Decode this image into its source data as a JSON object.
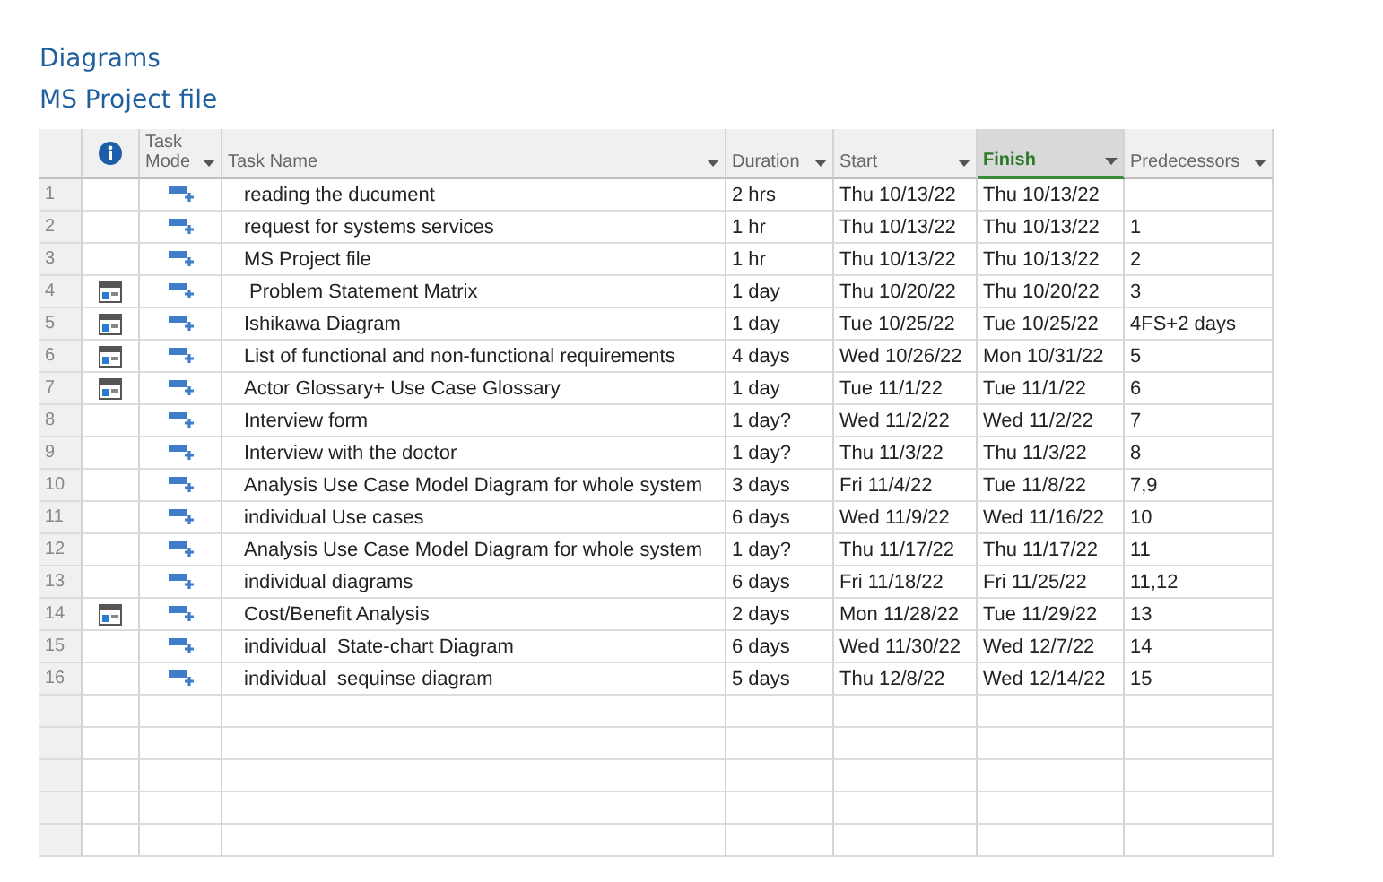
{
  "heading": "Diagrams",
  "subheading": "MS Project file",
  "columns": [
    {
      "kind": "number"
    },
    {
      "kind": "info"
    },
    {
      "kind": "text",
      "label": "Task Mode",
      "dropdown": true,
      "selected": false
    },
    {
      "kind": "text",
      "label": "Task Name",
      "dropdown": true,
      "selected": false
    },
    {
      "kind": "text",
      "label": "Duration",
      "dropdown": true,
      "selected": false
    },
    {
      "kind": "text",
      "label": "Start",
      "dropdown": true,
      "selected": false
    },
    {
      "kind": "text",
      "label": "Finish",
      "dropdown": true,
      "selected": true
    },
    {
      "kind": "text",
      "label": "Predecessors",
      "dropdown": true,
      "selected": false
    }
  ],
  "rows": [
    {
      "id": "1",
      "constraint": false,
      "name": "reading the ducument",
      "duration": "2 hrs",
      "start": "Thu 10/13/22",
      "finish": "Thu 10/13/22"
    },
    {
      "id": "2",
      "constraint": false,
      "name": "request for systems services",
      "duration": "1 hr",
      "start": "Thu 10/13/22",
      "finish": "Thu 10/13/22",
      "predecessors": "1"
    },
    {
      "id": "3",
      "constraint": false,
      "name": "MS Project file",
      "duration": "1 hr",
      "start": "Thu 10/13/22",
      "finish": "Thu 10/13/22",
      "predecessors": "2"
    },
    {
      "id": "4",
      "constraint": true,
      "name": " Problem Statement Matrix",
      "duration": "1 day",
      "start": "Thu 10/20/22",
      "finish": "Thu 10/20/22",
      "predecessors": "3"
    },
    {
      "id": "5",
      "constraint": true,
      "name": "Ishikawa Diagram",
      "duration": "1 day",
      "start": "Tue 10/25/22",
      "finish": "Tue 10/25/22",
      "predecessors": "4FS+2 days"
    },
    {
      "id": "6",
      "constraint": true,
      "name": "List of functional and non-functional requirements",
      "duration": "4 days",
      "start": "Wed 10/26/22",
      "finish": "Mon 10/31/22",
      "predecessors": "5"
    },
    {
      "id": "7",
      "constraint": true,
      "name": "Actor Glossary+ Use Case Glossary",
      "duration": "1 day",
      "start": "Tue 11/1/22",
      "finish": "Tue 11/1/22",
      "predecessors": "6"
    },
    {
      "id": "8",
      "constraint": false,
      "name": "Interview form",
      "duration": "1 day?",
      "start": "Wed 11/2/22",
      "finish": "Wed 11/2/22",
      "predecessors": "7"
    },
    {
      "id": "9",
      "constraint": false,
      "name": "Interview with the doctor",
      "duration": "1 day?",
      "start": "Thu 11/3/22",
      "finish": "Thu 11/3/22",
      "predecessors": "8"
    },
    {
      "id": "10",
      "constraint": false,
      "name": "Analysis Use Case Model Diagram for whole system",
      "duration": "3 days",
      "start": "Fri 11/4/22",
      "finish": "Tue 11/8/22",
      "predecessors": "7,9"
    },
    {
      "id": "11",
      "constraint": false,
      "name": "individual Use cases",
      "duration": "6 days",
      "start": "Wed 11/9/22",
      "finish": "Wed 11/16/22",
      "predecessors": "10"
    },
    {
      "id": "12",
      "constraint": false,
      "name": "Analysis Use Case Model Diagram for whole system",
      "duration": "1 day?",
      "start": "Thu 11/17/22",
      "finish": "Thu 11/17/22",
      "predecessors": "11"
    },
    {
      "id": "13",
      "constraint": false,
      "name": "individual diagrams",
      "duration": "6 days",
      "start": "Fri 11/18/22",
      "finish": "Fri 11/25/22",
      "predecessors": "11,12"
    },
    {
      "id": "14",
      "constraint": true,
      "name": "Cost/Benefit Analysis",
      "duration": "2 days",
      "start": "Mon 11/28/22",
      "finish": "Tue 11/29/22",
      "predecessors": "13"
    },
    {
      "id": "15",
      "constraint": false,
      "name": "individual  State-chart Diagram",
      "duration": "6 days",
      "start": "Wed 11/30/22",
      "finish": "Wed 12/7/22",
      "predecessors": "14"
    },
    {
      "id": "16",
      "constraint": false,
      "name": "individual  sequinse diagram",
      "duration": "5 days",
      "start": "Thu 12/8/22",
      "finish": "Wed 12/14/22",
      "predecessors": "15"
    }
  ]
}
